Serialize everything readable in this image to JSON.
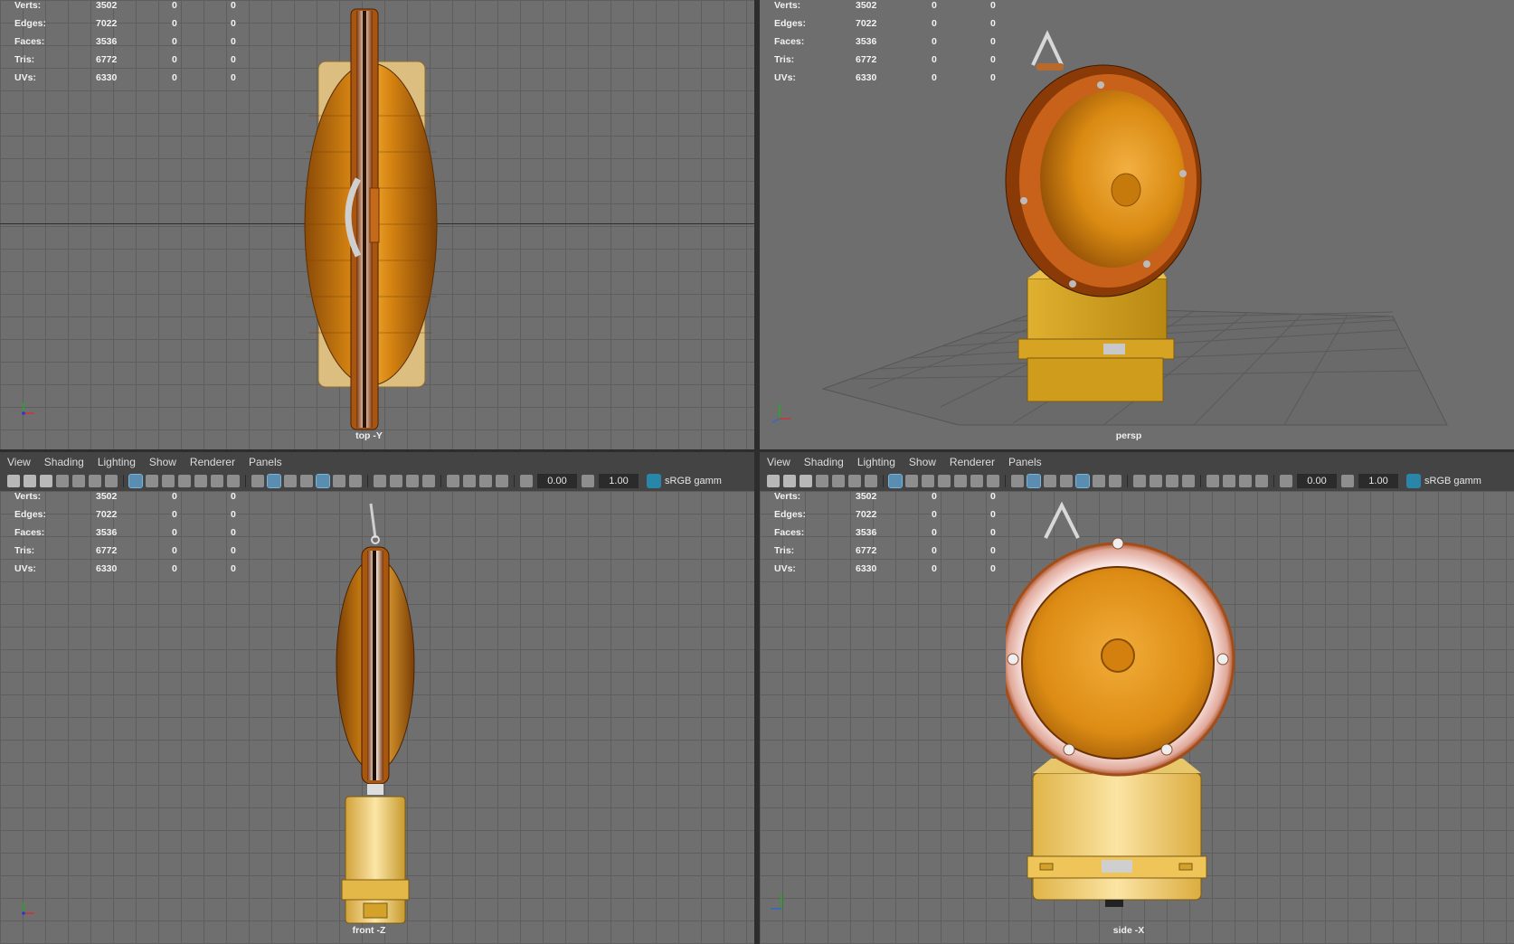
{
  "colors": {
    "viewport_bg": "#6f6f6f",
    "grid_line": "#5e5e5e",
    "toolbar_bg": "#444444",
    "accent": "#5a8db0",
    "lamp_amber": "#e8960f",
    "housing_yellow": "#d9a520"
  },
  "hud": {
    "labels": [
      "Verts:",
      "Edges:",
      "Faces:",
      "Tris:",
      "UVs:"
    ],
    "values": [
      [
        "3502",
        "0",
        "0"
      ],
      [
        "7022",
        "0",
        "0"
      ],
      [
        "3536",
        "0",
        "0"
      ],
      [
        "6772",
        "0",
        "0"
      ],
      [
        "6330",
        "0",
        "0"
      ]
    ]
  },
  "viewports": {
    "top": {
      "camera": "top -Y"
    },
    "persp": {
      "camera": "persp"
    },
    "front": {
      "camera": "front -Z"
    },
    "side": {
      "camera": "side -X"
    }
  },
  "menu": [
    "View",
    "Shading",
    "Lighting",
    "Show",
    "Renderer",
    "Panels"
  ],
  "toolbar": {
    "exposure": "0.00",
    "gamma": "1.00",
    "color_management": "sRGB gamm"
  },
  "icons": [
    "camera-icon",
    "grid-icon",
    "wireframe-icon",
    "smooth-shade-icon",
    "texture-icon",
    "light-icon",
    "isolate-icon",
    "color-management-icon"
  ]
}
